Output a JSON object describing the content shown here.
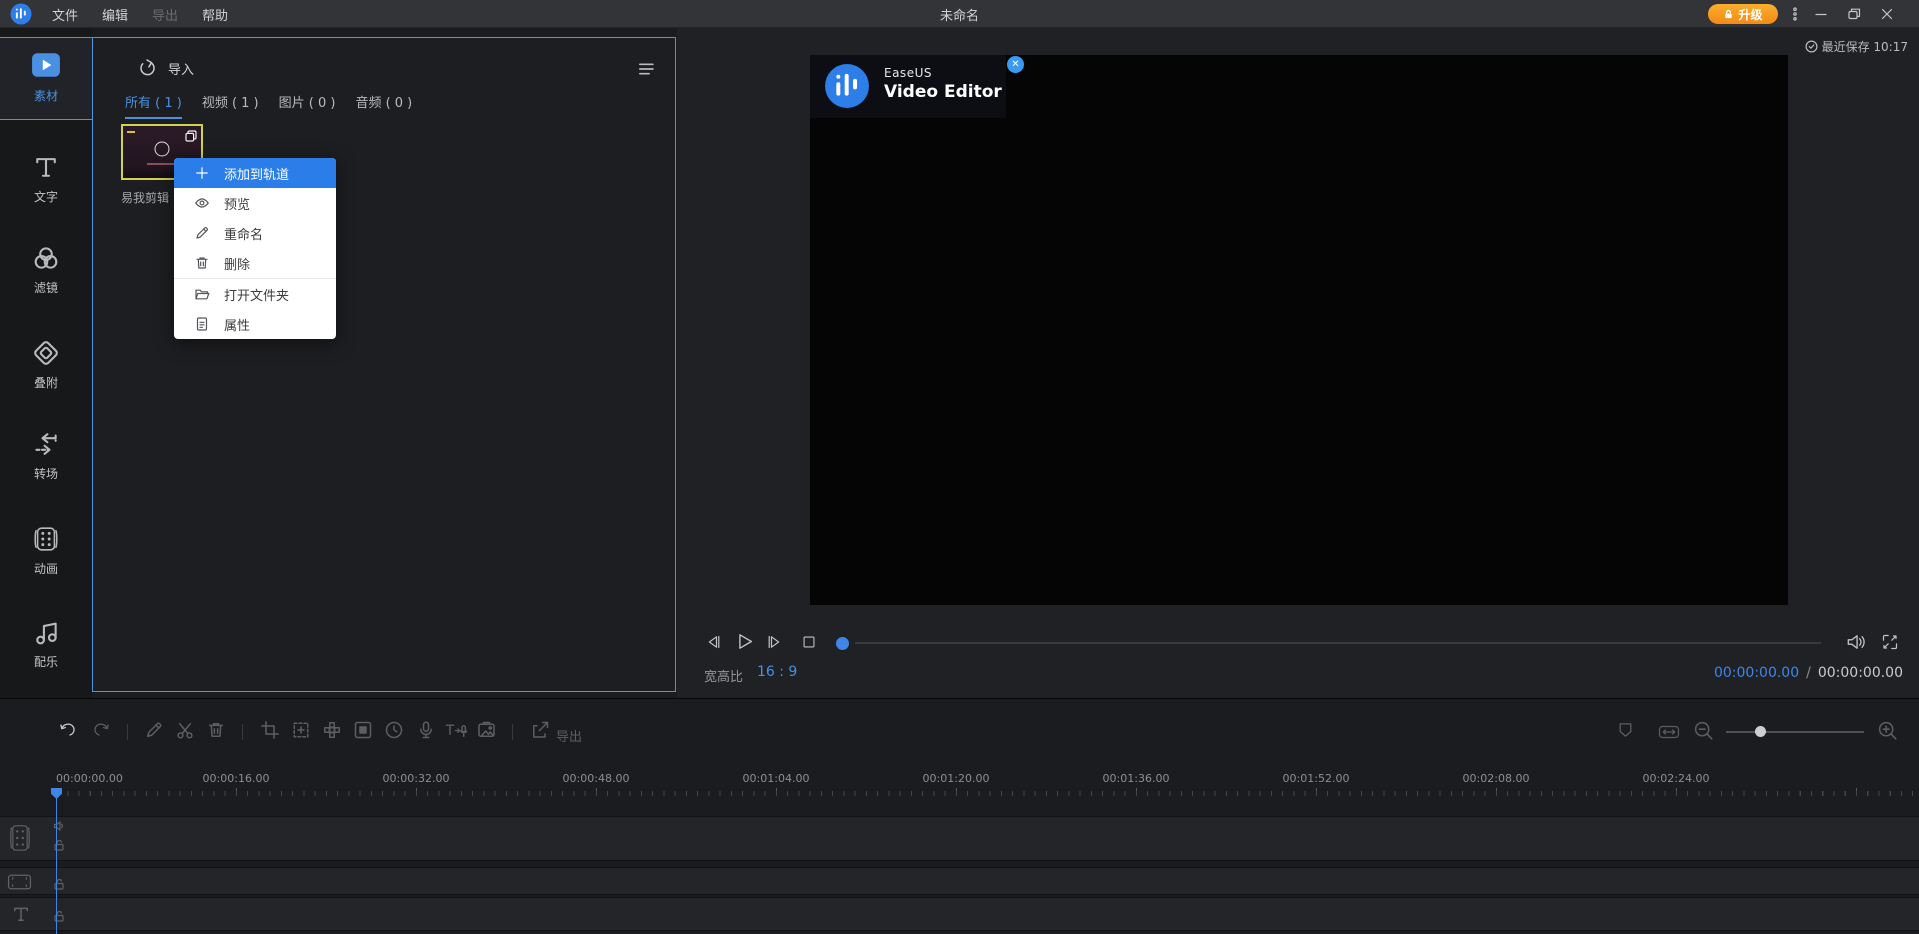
{
  "topbar": {
    "title": "未命名",
    "menu": [
      {
        "label": "文件",
        "enabled": true
      },
      {
        "label": "编辑",
        "enabled": true
      },
      {
        "label": "导出",
        "enabled": false
      },
      {
        "label": "帮助",
        "enabled": true
      }
    ],
    "upgrade_label": "升级",
    "window_icons": [
      "kebab-menu-icon",
      "minimize-icon",
      "maximize-icon",
      "close-icon"
    ]
  },
  "sidebar": {
    "items": [
      {
        "label": "素材",
        "icon": "media-library-icon",
        "active": true
      },
      {
        "label": "文字",
        "icon": "text-icon",
        "active": false
      },
      {
        "label": "滤镜",
        "icon": "filter-icon",
        "active": false
      },
      {
        "label": "叠附",
        "icon": "overlay-icon",
        "active": false
      },
      {
        "label": "转场",
        "icon": "transition-icon",
        "active": false
      },
      {
        "label": "动画",
        "icon": "animation-icon",
        "active": false
      },
      {
        "label": "配乐",
        "icon": "music-icon",
        "active": false
      }
    ]
  },
  "media_panel": {
    "import_label": "导入",
    "view_icon": "list-view-icon",
    "tabs": [
      {
        "label": "所有 ( 1 )",
        "active": true
      },
      {
        "label": "视频 ( 1 )",
        "active": false
      },
      {
        "label": "图片 ( 0 )",
        "active": false
      },
      {
        "label": "音频 ( 0 )",
        "active": false
      }
    ],
    "clip": {
      "name": "易我剪辑",
      "selected": true,
      "border_color": "#cfd24e"
    }
  },
  "context_menu": {
    "items": [
      {
        "label": "添加到轨道",
        "icon": "plus-icon",
        "highlighted": true
      },
      {
        "label": "预览",
        "icon": "eye-icon",
        "highlighted": false
      },
      {
        "label": "重命名",
        "icon": "pencil-icon",
        "highlighted": false
      },
      {
        "label": "删除",
        "icon": "trash-icon",
        "highlighted": false,
        "separator_after": true
      },
      {
        "label": "打开文件夹",
        "icon": "folder-icon",
        "highlighted": false
      },
      {
        "label": "属性",
        "icon": "properties-icon",
        "highlighted": false
      }
    ]
  },
  "preview": {
    "saved_status": "最近保存 10:17",
    "watermark": {
      "brand": "EaseUS",
      "product": "Video Editor"
    },
    "aspect_label": "宽高比",
    "aspect_value": "16 : 9",
    "current_time": "00:00:00.00",
    "time_separator": "/",
    "total_time": "00:00:00.00"
  },
  "toolbar": {
    "export_label": "导出",
    "icons": [
      "undo-icon",
      "redo-icon",
      "edit-icon",
      "cut-icon",
      "delete-icon",
      "crop-icon",
      "zoom-select-icon",
      "mosaic-icon",
      "freeze-frame-icon",
      "duration-icon",
      "record-voiceover-icon",
      "text-to-speech-icon",
      "snapshot-icon",
      "export-icon",
      "marker-icon",
      "fit-timeline-icon",
      "zoom-out-icon",
      "zoom-in-icon"
    ]
  },
  "timeline": {
    "ruler_labels": [
      "00:00:00.00",
      "00:00:16.00",
      "00:00:32.00",
      "00:00:48.00",
      "00:01:04.00",
      "00:01:20.00",
      "00:01:36.00",
      "00:01:52.00",
      "00:02:08.00",
      "00:02:24.00"
    ],
    "tracks": [
      {
        "type": "video-track",
        "icons": [
          "film-strip-icon",
          "speaker-icon",
          "unlock-icon"
        ]
      },
      {
        "type": "overlay-track",
        "icons": [
          "film-strip-h-icon",
          "unlock-icon"
        ]
      },
      {
        "type": "text-track",
        "icons": [
          "text-track-icon",
          "unlock-icon"
        ]
      }
    ]
  },
  "colors": {
    "accent_blue": "#3f86e8",
    "menu_highlight": "#2b7de9",
    "panel_border": "#4a97db",
    "upgrade_orange": "#f48a17",
    "thumbnail_border": "#cfd24e"
  }
}
